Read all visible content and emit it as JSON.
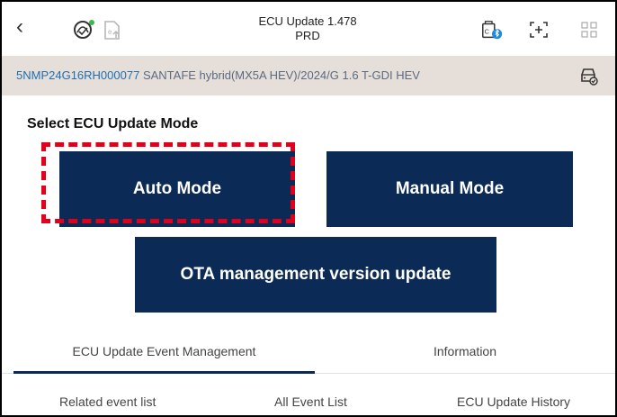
{
  "header": {
    "title_line1": "ECU Update 1.478",
    "title_line2": "PRD",
    "icons": [
      "back-icon",
      "vci-status-icon",
      "export-icon",
      "vci-bluetooth-icon",
      "fullscreen-icon",
      "grid-menu-icon"
    ]
  },
  "vehicle": {
    "vin": "5NMP24G16RH000077",
    "description": "SANTAFE hybrid(MX5A HEV)/2024/G 1.6 T-GDI HEV",
    "icon": "vehicle-check-icon"
  },
  "main": {
    "section_title": "Select ECU Update Mode",
    "auto_mode_label": "Auto Mode",
    "manual_mode_label": "Manual Mode",
    "ota_label": "OTA management version update",
    "button_color": "#0b2a55",
    "highlight_color": "#e0001b"
  },
  "tabs": [
    {
      "label": "ECU Update Event Management",
      "active": true
    },
    {
      "label": "Information",
      "active": false
    }
  ],
  "subtabs": [
    {
      "label": "Related event list"
    },
    {
      "label": "All Event List"
    },
    {
      "label": "ECU Update History"
    }
  ]
}
